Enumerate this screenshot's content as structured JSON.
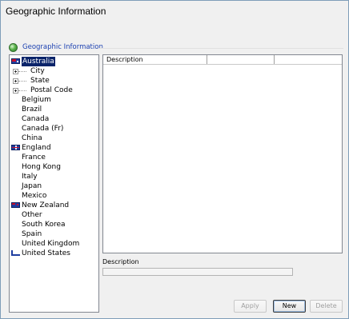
{
  "window": {
    "title": "Geographic Information"
  },
  "group": {
    "label": "Geographic Information",
    "icon": "globe-icon"
  },
  "tree": {
    "items": [
      {
        "label": "Australia",
        "icon": "flag-australia-icon",
        "selected": true
      },
      {
        "label": "City",
        "icon": "expand-icon",
        "child": true
      },
      {
        "label": "State",
        "icon": "expand-icon",
        "child": true
      },
      {
        "label": "Postal Code",
        "icon": "expand-icon",
        "child": true
      },
      {
        "label": "Belgium"
      },
      {
        "label": "Brazil"
      },
      {
        "label": "Canada"
      },
      {
        "label": "Canada (Fr)"
      },
      {
        "label": "China"
      },
      {
        "label": "England",
        "icon": "flag-england-icon"
      },
      {
        "label": "France"
      },
      {
        "label": "Hong Kong"
      },
      {
        "label": "Italy"
      },
      {
        "label": "Japan"
      },
      {
        "label": "Mexico"
      },
      {
        "label": "New Zealand",
        "icon": "flag-new-zealand-icon"
      },
      {
        "label": "Other"
      },
      {
        "label": "South Korea"
      },
      {
        "label": "Spain"
      },
      {
        "label": "United Kingdom"
      },
      {
        "label": "United States",
        "icon": "flag-united-states-icon"
      }
    ]
  },
  "list": {
    "columns": [
      "Description",
      ""
    ]
  },
  "detail": {
    "description_label": "Description",
    "description_value": ""
  },
  "buttons": {
    "apply": "Apply",
    "new": "New",
    "delete": "Delete"
  },
  "colors": {
    "selection": "#0a246a",
    "group_label": "#1a3fb0",
    "border": "#7f9db9"
  }
}
